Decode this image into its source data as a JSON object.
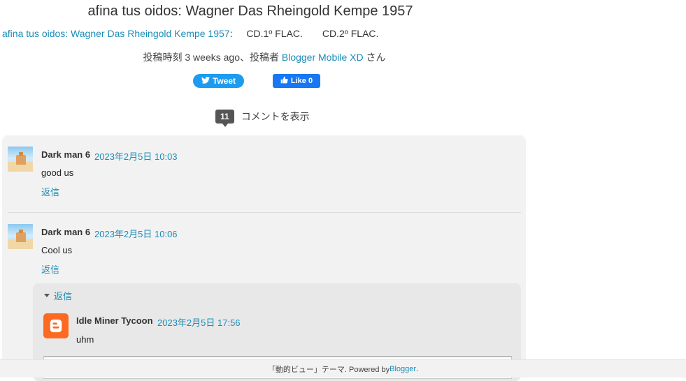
{
  "post": {
    "title": "afina tus oidos: Wagner Das Rheingold Kempe 1957",
    "link_title": "afina tus oidos: Wagner Das Rheingold Kempe 1957",
    "link_separator": ":",
    "cd1": "CD.1º FLAC.",
    "cd2": "CD.2º FLAC.",
    "meta_prefix": "投稿時刻",
    "meta_time": "3 weeks ago",
    "meta_mid": "、投稿者",
    "meta_author": "Blogger Mobile XD",
    "meta_suffix": "さん"
  },
  "share": {
    "tweet_label": "Tweet",
    "like_label": "Like 0"
  },
  "comments_toggle": {
    "count": "11",
    "label": "コメントを表示"
  },
  "comments": [
    {
      "author": "Dark man 6",
      "date": "2023年2月5日 10:03",
      "text": "good us",
      "reply_label": "返信"
    },
    {
      "author": "Dark man 6",
      "date": "2023年2月5日 10:06",
      "text": "Cool us",
      "reply_label": "返信"
    }
  ],
  "replies": {
    "toggle_label": "返信",
    "items": [
      {
        "author": "Idle Miner Tycoon",
        "date": "2023年2月5日 17:56",
        "text": "uhm"
      }
    ]
  },
  "footer": {
    "theme": "「動的ビュー」テーマ. Powered by ",
    "link": "Blogger",
    "end": "."
  },
  "colors": {
    "link": "#1c8db8",
    "tweet": "#1d9bf0",
    "like": "#1877f2",
    "blogger": "#fc6a21"
  },
  "icons": [
    "twitter-bird-icon",
    "thumbs-up-icon",
    "blogger-icon",
    "triangle-down-icon"
  ]
}
